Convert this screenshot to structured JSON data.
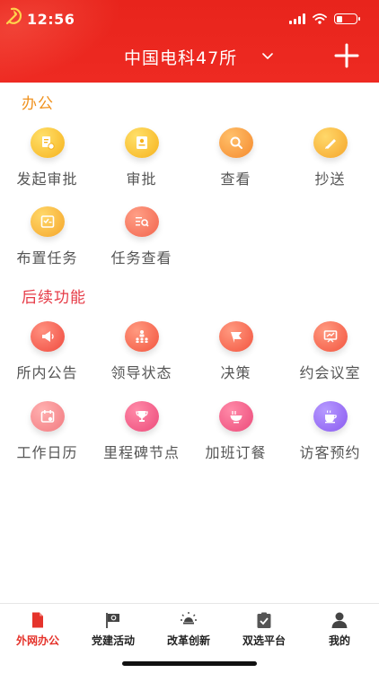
{
  "status_bar": {
    "time": "12:56",
    "battery_level": 0.3
  },
  "header": {
    "org_title": "中国电科47所",
    "menu_icon": "chevron-down-icon",
    "add_icon": "plus-icon"
  },
  "colors": {
    "brand_red": "#e8241c",
    "section_office": "#f0921f",
    "section_followup": "#e63a46",
    "tab_active": "#e5332b"
  },
  "sections": [
    {
      "title": "办公",
      "items": [
        {
          "label": "发起审批",
          "icon": "document-stamp-icon"
        },
        {
          "label": "审批",
          "icon": "approval-icon"
        },
        {
          "label": "查看",
          "icon": "magnifier-icon"
        },
        {
          "label": "抄送",
          "icon": "pencil-icon"
        },
        {
          "label": "布置任务",
          "icon": "task-list-icon"
        },
        {
          "label": "任务查看",
          "icon": "task-search-icon"
        }
      ]
    },
    {
      "title": "后续功能",
      "items": [
        {
          "label": "所内公告",
          "icon": "megaphone-icon"
        },
        {
          "label": "领导状态",
          "icon": "org-chart-icon"
        },
        {
          "label": "决策",
          "icon": "flag-icon"
        },
        {
          "label": "约会议室",
          "icon": "presentation-board-icon"
        },
        {
          "label": "工作日历",
          "icon": "calendar-icon"
        },
        {
          "label": "里程碑节点",
          "icon": "trophy-icon"
        },
        {
          "label": "加班订餐",
          "icon": "noodle-bowl-icon"
        },
        {
          "label": "访客预约",
          "icon": "coffee-cup-icon"
        }
      ]
    }
  ],
  "tabbar": [
    {
      "label": "外网办公",
      "icon": "document-icon",
      "active": true
    },
    {
      "label": "党建活动",
      "icon": "party-flag-icon",
      "active": false
    },
    {
      "label": "改革创新",
      "icon": "lightbulb-icon",
      "active": false
    },
    {
      "label": "双选平台",
      "icon": "clipboard-check-icon",
      "active": false
    },
    {
      "label": "我的",
      "icon": "person-icon",
      "active": false
    }
  ]
}
